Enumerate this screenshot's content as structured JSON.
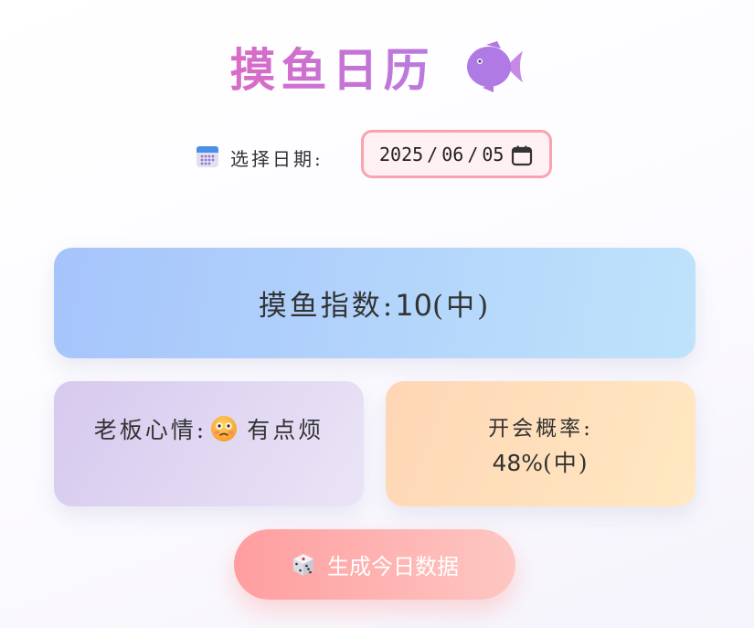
{
  "header": {
    "title": "摸鱼日历",
    "icon": "fish-icon",
    "accent_color": "#b87adf"
  },
  "date_picker": {
    "icon": "calendar-emoji-icon",
    "label": "选择日期:",
    "year": "2025",
    "month": "06",
    "day": "05",
    "separator": "/",
    "picker_icon": "calendar-picker-icon",
    "border_color": "#f7a4ad"
  },
  "cards": {
    "fishing_index": {
      "label": "摸鱼指数:",
      "value": "10",
      "level": "(中)"
    },
    "boss_mood": {
      "label": "老板心情:",
      "icon": "flushed-face-emoji-icon",
      "value": "有点烦"
    },
    "meeting_probability": {
      "label": "开会概率:",
      "value": "48%",
      "level": "(中)"
    }
  },
  "generate_button": {
    "icon": "dice-icon",
    "label": "生成今日数据",
    "color": "#ff9d9f"
  }
}
